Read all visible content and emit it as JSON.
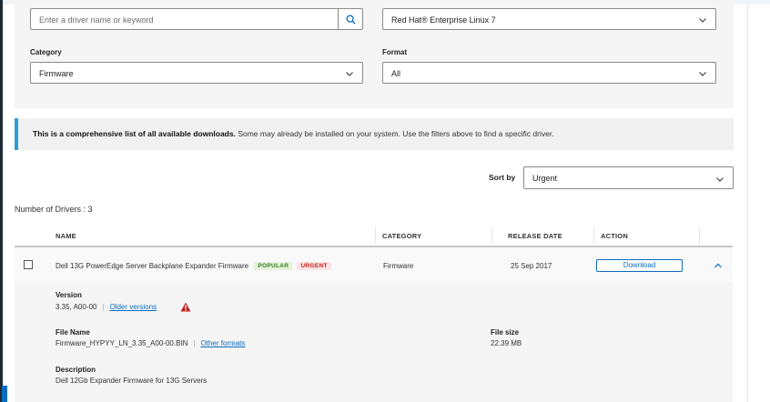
{
  "filters": {
    "search_placeholder": "Enter a driver name or keyword",
    "os_value": "Red Hat® Enterprise Linux 7",
    "category_label": "Category",
    "category_value": "Firmware",
    "format_label": "Format",
    "format_value": "All"
  },
  "notice": {
    "bold": "This is a comprehensive list of all available downloads.",
    "rest": " Some may already be installed on your system. Use the filters above to find a specific driver."
  },
  "sort": {
    "label": "Sort by",
    "value": "Urgent"
  },
  "count_text": "Number of Drivers : 3",
  "table": {
    "headers": {
      "name": "NAME",
      "category": "CATEGORY",
      "release_date": "RELEASE DATE",
      "action": "ACTION"
    },
    "rows": [
      {
        "name": "Dell 13G PowerEdge Server Backplane Expander Firmware",
        "badges": [
          "POPULAR",
          "URGENT"
        ],
        "category": "Firmware",
        "release_date": "25 Sep 2017",
        "action": "Download"
      }
    ]
  },
  "details": {
    "version_label": "Version",
    "version_value": "3.35, A00-00",
    "older_versions": "Older versions",
    "file_name_label": "File Name",
    "file_name_value": "Firmware_HYPYY_LN_3.35_A00-00.BIN",
    "other_formats": "Other formats",
    "file_size_label": "File size",
    "file_size_value": "22.39 MB",
    "description_label": "Description",
    "description_value": "Dell 12Gb Expander Firmware for 13G Servers"
  },
  "colors": {
    "accent": "#0b6cbf",
    "notice_bar": "#2c9fd9",
    "popular": "#357a1c",
    "urgent": "#c3201f"
  }
}
